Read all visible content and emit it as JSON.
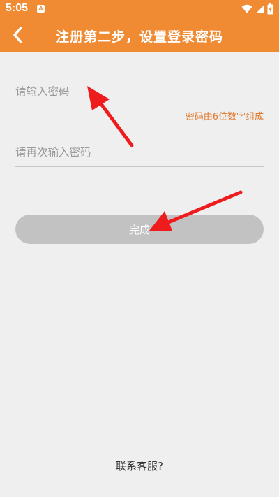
{
  "status_bar": {
    "time": "5:05",
    "notification_icon_letter": "A",
    "icons": [
      "wifi-icon",
      "signal-icon",
      "battery-icon"
    ]
  },
  "header": {
    "title": "注册第二步，设置登录密码",
    "back_icon": "chevron-left-icon",
    "background_color": "#f08a33"
  },
  "form": {
    "password_placeholder": "请输入密码",
    "password_value": "",
    "password_hint": "密码由6位数字组成",
    "confirm_placeholder": "请再次输入密码",
    "confirm_value": ""
  },
  "actions": {
    "done_label": "完成"
  },
  "footer": {
    "contact_label": "联系客服?"
  },
  "colors": {
    "accent": "#f08a33",
    "hint": "#e07a2c",
    "button_disabled": "#c2c2c2",
    "annotation_arrow": "#ee1c1c"
  }
}
